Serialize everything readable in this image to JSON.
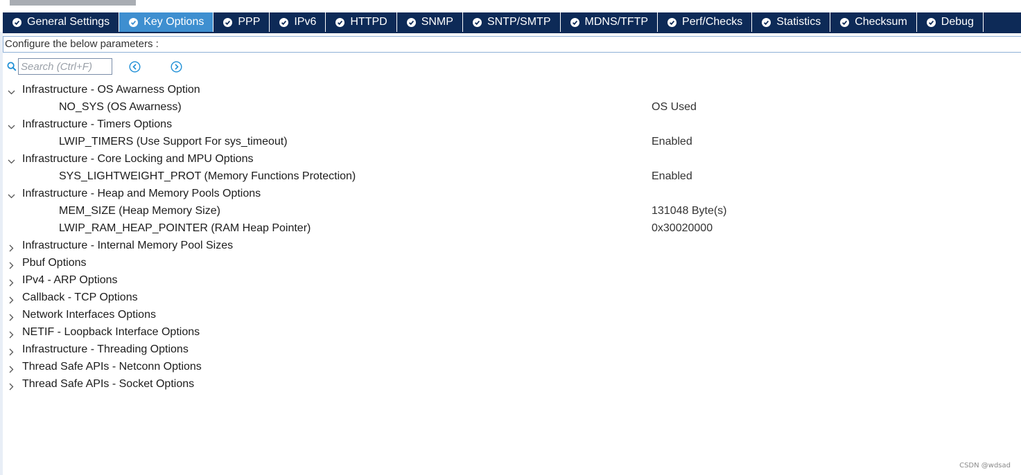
{
  "tabs": [
    {
      "label": "General Settings",
      "active": false
    },
    {
      "label": "Key Options",
      "active": true
    },
    {
      "label": "PPP",
      "active": false
    },
    {
      "label": "IPv6",
      "active": false
    },
    {
      "label": "HTTPD",
      "active": false
    },
    {
      "label": "SNMP",
      "active": false
    },
    {
      "label": "SNTP/SMTP",
      "active": false
    },
    {
      "label": "MDNS/TFTP",
      "active": false
    },
    {
      "label": "Perf/Checks",
      "active": false
    },
    {
      "label": "Statistics",
      "active": false
    },
    {
      "label": "Checksum",
      "active": false
    },
    {
      "label": "Debug",
      "active": false
    }
  ],
  "configure_text": "Configure the below parameters :",
  "search": {
    "placeholder": "Search (Ctrl+F)",
    "value": ""
  },
  "tree": [
    {
      "category": "Infrastructure - OS Awarness Option",
      "expanded": true,
      "params": [
        {
          "name": "NO_SYS (OS Awarness)",
          "value": "OS Used"
        }
      ]
    },
    {
      "category": "Infrastructure - Timers Options",
      "expanded": true,
      "params": [
        {
          "name": "LWIP_TIMERS (Use Support For sys_timeout)",
          "value": "Enabled"
        }
      ]
    },
    {
      "category": "Infrastructure - Core Locking and MPU Options",
      "expanded": true,
      "params": [
        {
          "name": "SYS_LIGHTWEIGHT_PROT (Memory Functions Protection)",
          "value": "Enabled"
        }
      ]
    },
    {
      "category": "Infrastructure - Heap and Memory Pools Options",
      "expanded": true,
      "params": [
        {
          "name": "MEM_SIZE (Heap Memory Size)",
          "value": "131048 Byte(s)"
        },
        {
          "name": "LWIP_RAM_HEAP_POINTER (RAM Heap Pointer)",
          "value": "0x30020000"
        }
      ]
    },
    {
      "category": "Infrastructure - Internal Memory Pool Sizes",
      "expanded": false,
      "params": []
    },
    {
      "category": "Pbuf Options",
      "expanded": false,
      "params": []
    },
    {
      "category": "IPv4 - ARP Options",
      "expanded": false,
      "params": []
    },
    {
      "category": "Callback - TCP Options",
      "expanded": false,
      "params": []
    },
    {
      "category": "Network Interfaces Options",
      "expanded": false,
      "params": []
    },
    {
      "category": "NETIF - Loopback Interface Options",
      "expanded": false,
      "params": []
    },
    {
      "category": "Infrastructure - Threading Options",
      "expanded": false,
      "params": []
    },
    {
      "category": "Thread Safe APIs - Netconn Options",
      "expanded": false,
      "params": []
    },
    {
      "category": "Thread Safe APIs - Socket Options",
      "expanded": false,
      "params": []
    }
  ],
  "watermark": "CSDN @wdsad",
  "colors": {
    "tabbar_bg": "#0d2a57",
    "tab_active_bg": "#3e8fd0",
    "icon_blue": "#1e8fd6"
  },
  "icons": {
    "tab_status": "check-circle-icon",
    "search": "search-icon",
    "prev": "chevron-left-circle-icon",
    "next": "chevron-right-circle-icon",
    "expanded": "chevron-down-icon",
    "collapsed": "chevron-right-icon"
  }
}
